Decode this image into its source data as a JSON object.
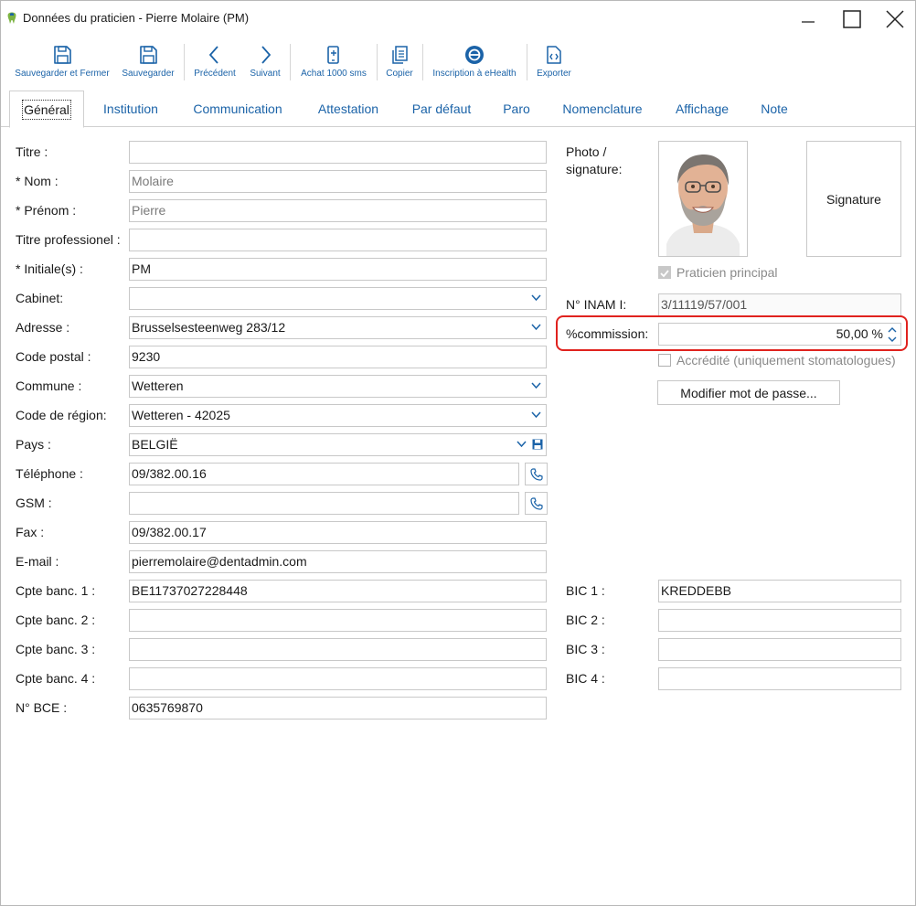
{
  "window": {
    "title": "Données du praticien - Pierre Molaire (PM)"
  },
  "toolbar": {
    "items": [
      {
        "label": "Sauvegarder et Fermer",
        "icon": "save-icon"
      },
      {
        "label": "Sauvegarder",
        "icon": "save-icon"
      },
      {
        "label": "Précédent",
        "icon": "chevron-left-icon"
      },
      {
        "label": "Suivant",
        "icon": "chevron-right-icon"
      },
      {
        "label": "Achat 1000 sms",
        "icon": "sms-phone-icon"
      },
      {
        "label": "Copier",
        "icon": "copy-icon"
      },
      {
        "label": "Inscription à eHealth",
        "icon": "ehealth-icon"
      },
      {
        "label": "Exporter",
        "icon": "export-icon"
      }
    ]
  },
  "tabs": [
    "Général",
    "Institution",
    "Communication",
    "Attestation",
    "Par défaut",
    "Paro",
    "Nomenclature",
    "Affichage",
    "Note"
  ],
  "form": {
    "titre": {
      "label": "Titre :",
      "value": ""
    },
    "nom": {
      "label": "* Nom :",
      "value": "Molaire"
    },
    "prenom": {
      "label": "* Prénom :",
      "value": "Pierre"
    },
    "titre_pro": {
      "label": "Titre professionel :",
      "value": ""
    },
    "initiales": {
      "label": "* Initiale(s) :",
      "value": "PM"
    },
    "cabinet": {
      "label": "Cabinet:",
      "value": ""
    },
    "adresse": {
      "label": "Adresse :",
      "value": "Brusselsesteenweg 283/12"
    },
    "code_postal": {
      "label": "Code postal :",
      "value": "9230"
    },
    "commune": {
      "label": "Commune :",
      "value": "Wetteren"
    },
    "code_region": {
      "label": "Code de région:",
      "value": "Wetteren - 42025"
    },
    "pays": {
      "label": "Pays :",
      "value": "BELGIË"
    },
    "telephone": {
      "label": "Téléphone :",
      "value": "09/382.00.16"
    },
    "gsm": {
      "label": "GSM :",
      "value": ""
    },
    "fax": {
      "label": "Fax :",
      "value": "09/382.00.17"
    },
    "email": {
      "label": "E-mail :",
      "value": "pierremolaire@dentadmin.com"
    },
    "cpte1": {
      "label": "Cpte banc. 1 :",
      "value": "BE11737027228448"
    },
    "cpte2": {
      "label": "Cpte banc. 2 :",
      "value": ""
    },
    "cpte3": {
      "label": "Cpte banc. 3 :",
      "value": ""
    },
    "cpte4": {
      "label": "Cpte banc. 4 :",
      "value": ""
    },
    "bce": {
      "label": "N° BCE :",
      "value": "0635769870"
    }
  },
  "right": {
    "photo_label_1": "Photo /",
    "photo_label_2": "signature:",
    "signature": "Signature",
    "praticien_principal": {
      "label": "Praticien principal",
      "checked": true
    },
    "inami": {
      "label": "N° INAM I:",
      "value": "3/11119/57/001"
    },
    "commission": {
      "label": "%commission:",
      "value": "50,00 %"
    },
    "accredite": {
      "label": "Accrédité (uniquement stomatologues)",
      "checked": false
    },
    "modifier_pwd": "Modifier mot de passe...",
    "bic1": {
      "label": "BIC 1 :",
      "value": "KREDDEBB"
    },
    "bic2": {
      "label": "BIC 2 :",
      "value": ""
    },
    "bic3": {
      "label": "BIC 3 :",
      "value": ""
    },
    "bic4": {
      "label": "BIC 4 :",
      "value": ""
    }
  },
  "colors": {
    "accent": "#1b63a8",
    "highlight": "#e0221e"
  }
}
